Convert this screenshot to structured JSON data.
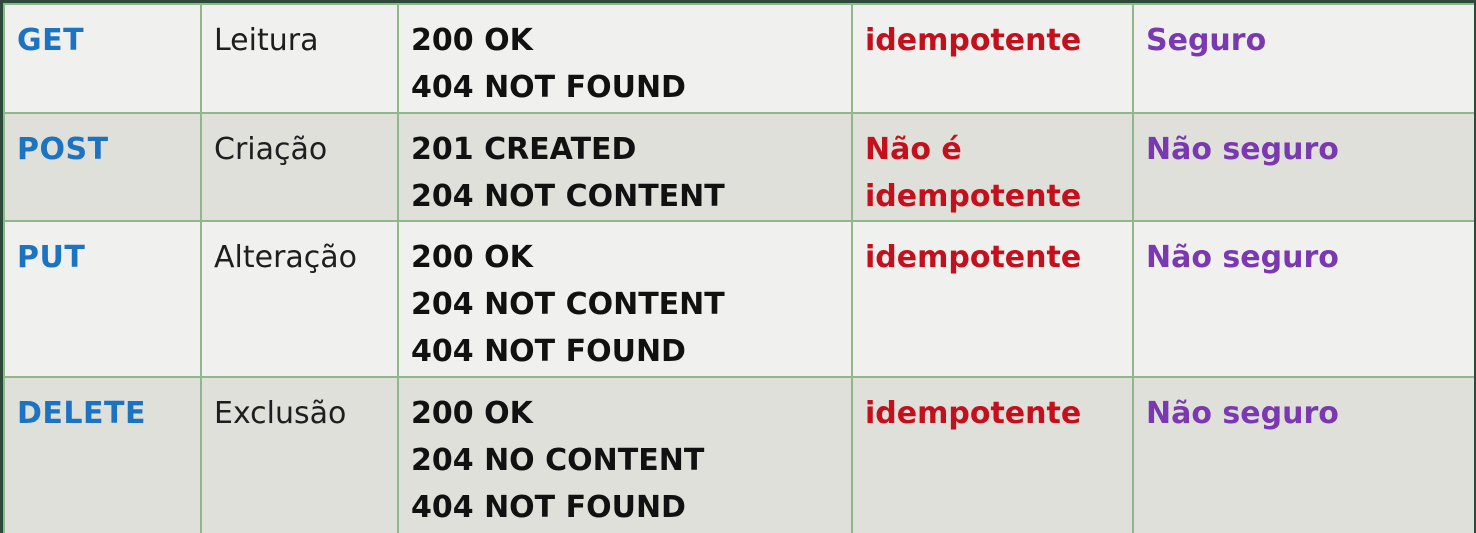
{
  "table": {
    "rows": [
      {
        "method": "GET",
        "operation": "Leitura",
        "codes": [
          "200 OK",
          "404 NOT FOUND"
        ],
        "idempotency": [
          "idempotente"
        ],
        "safety": "Seguro"
      },
      {
        "method": "POST",
        "operation": "Criação",
        "codes": [
          "201 CREATED",
          "204 NOT CONTENT"
        ],
        "idempotency": [
          "Não é",
          "idempotente"
        ],
        "safety": "Não seguro"
      },
      {
        "method": "PUT",
        "operation": "Alteração",
        "codes": [
          "200 OK",
          "204 NOT CONTENT",
          "404 NOT FOUND"
        ],
        "idempotency": [
          "idempotente"
        ],
        "safety": "Não seguro"
      },
      {
        "method": "DELETE",
        "operation": "Exclusão",
        "codes": [
          "200 OK",
          "204 NO CONTENT",
          "404 NOT FOUND"
        ],
        "idempotency": [
          "idempotente"
        ],
        "safety": "Não seguro"
      }
    ]
  },
  "colors": {
    "method": "#1c73c2",
    "idempotency": "#c4101c",
    "safety": "#7a39b0",
    "border": "#8fb88a",
    "row_light": "#f0f0ee",
    "row_dark": "#dfe0da"
  }
}
